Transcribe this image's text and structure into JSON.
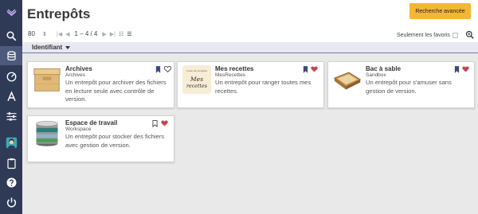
{
  "app": {
    "title": "Entrepôts"
  },
  "header": {
    "advanced_search_label": "Recherche avancée"
  },
  "pager": {
    "page_size": "80",
    "range": "1 – 4 / 4"
  },
  "favorites": {
    "label": "Seulement les favoris"
  },
  "sort": {
    "label": "Identifiant"
  },
  "sidebar": {
    "items": [
      {
        "icon": "app-logo-icon"
      },
      {
        "icon": "search-icon"
      },
      {
        "icon": "database-icon"
      },
      {
        "icon": "dashboard-icon"
      },
      {
        "icon": "text-font-icon"
      },
      {
        "icon": "sliders-icon"
      },
      {
        "icon": "user-avatar-icon"
      },
      {
        "icon": "clipboard-icon"
      },
      {
        "icon": "help-icon"
      },
      {
        "icon": "power-icon"
      }
    ]
  },
  "repositories": [
    {
      "title": "Archives",
      "subtitle": "Archives",
      "description": "Un entrepôt pour archiver des fichiers en lecture seule avec contrôle de version.",
      "bookmarked": true,
      "favorite": false,
      "image": "archive-box"
    },
    {
      "title": "Mes recettes",
      "subtitle": "MesRecettes",
      "description": "Un entrepôt pour ranger toutes mes recettes.",
      "bookmarked": true,
      "favorite": true,
      "image": "recipe-note",
      "image_text": [
        "Liste de recettes",
        "Mes",
        "recettes"
      ]
    },
    {
      "title": "Bac à sable",
      "subtitle": "Sandbox",
      "description": "Un entrepôt pour s'amuser sans gestion de version.",
      "bookmarked": true,
      "favorite": true,
      "image": "sandbox-tray"
    },
    {
      "title": "Espace de travail",
      "subtitle": "Workspace",
      "description": "Un entrepôt pour stocker des fichiers avec gestion de version.",
      "bookmarked": false,
      "favorite": true,
      "image": "server-stack"
    }
  ],
  "colors": {
    "sidebar": "#2f3a57",
    "accent": "#f4b731",
    "favorite": "#c0454f",
    "bookmark": "#3c4a7a"
  }
}
